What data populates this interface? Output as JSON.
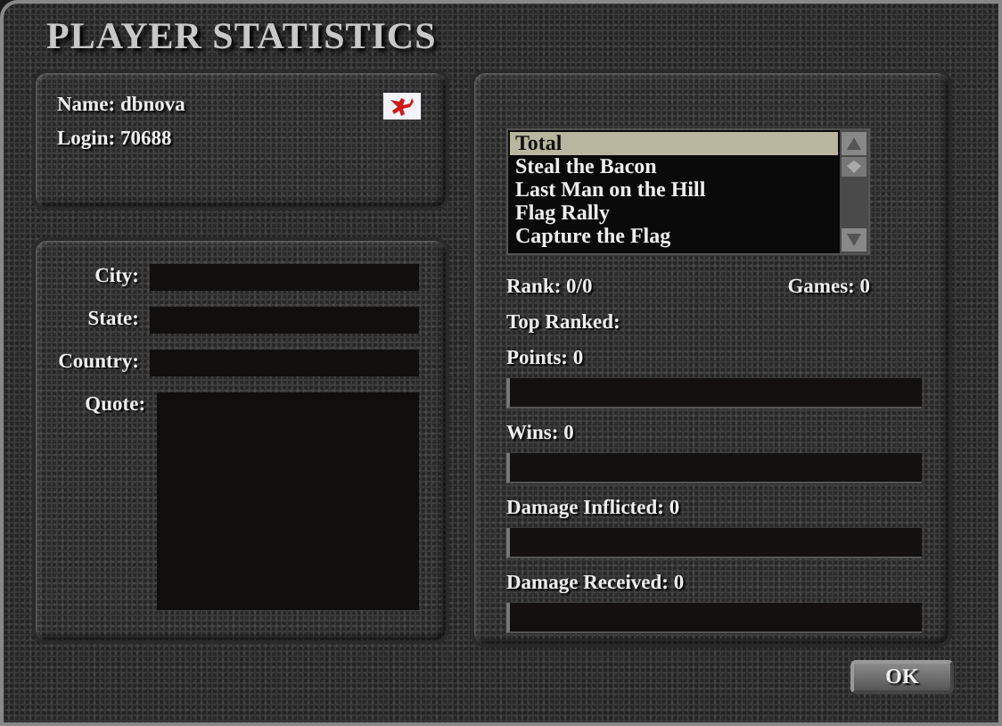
{
  "window": {
    "title": "PLAYER STATISTICS"
  },
  "profile": {
    "name": "Name: dbnova",
    "login": "Login: 70688"
  },
  "details": [
    {
      "label": "City:",
      "kind": "line"
    },
    {
      "label": "State:",
      "kind": "line"
    },
    {
      "label": "Country:",
      "kind": "line"
    },
    {
      "label": "Quote:",
      "kind": "area"
    }
  ],
  "game_types": [
    {
      "label": "Total",
      "selected": true
    },
    {
      "label": "Steal the Bacon",
      "selected": false
    },
    {
      "label": "Last Man on the Hill",
      "selected": false
    },
    {
      "label": "Flag Rally",
      "selected": false
    },
    {
      "label": "Capture the Flag",
      "selected": false
    }
  ],
  "rank": "Rank: 0/0",
  "games": "Games: 0",
  "top_ranked": "Top Ranked:",
  "meters": [
    {
      "label": "Points: 0"
    },
    {
      "label": "Wins: 0"
    },
    {
      "label": "Damage Inflicted: 0"
    },
    {
      "label": "Damage Received: 0"
    }
  ],
  "buttons": [
    "OK"
  ]
}
